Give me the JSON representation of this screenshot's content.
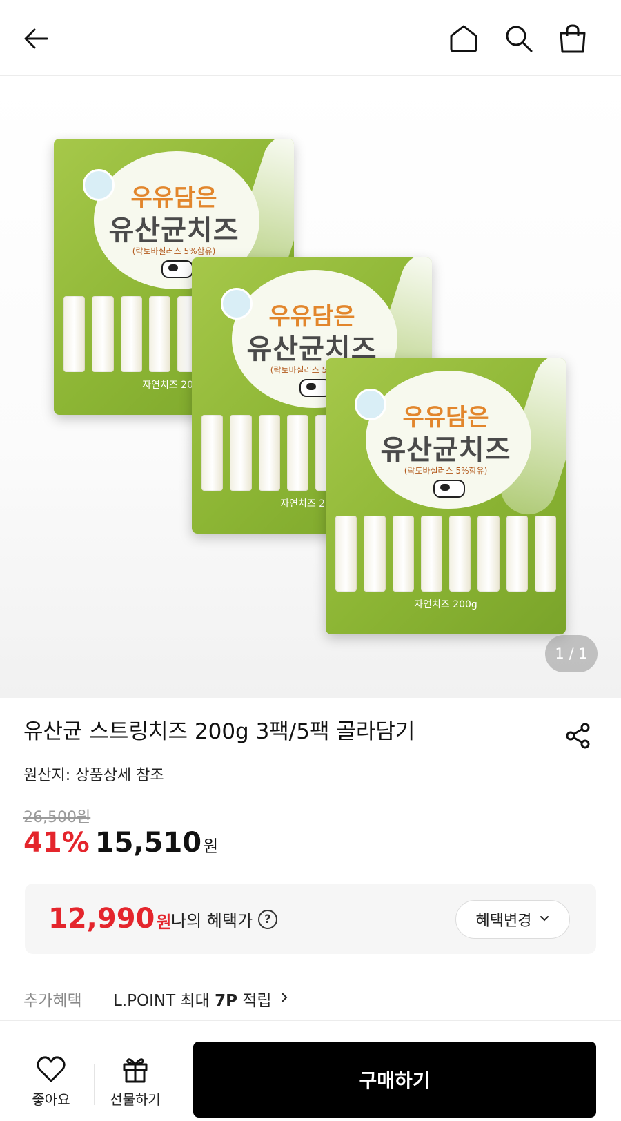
{
  "header": {
    "back_icon": "arrow-left-icon",
    "home_icon": "home-icon",
    "search_icon": "search-icon",
    "cart_icon": "shopping-bag-icon"
  },
  "gallery": {
    "counter": "1 / 1",
    "package": {
      "line1": "우유담은",
      "line2": "유산균치즈",
      "line3": "(락토바실러스 5%함유)",
      "net_weight": "자연치즈 200g"
    }
  },
  "product": {
    "title": "유산균 스트링치즈 200g 3팩/5팩 골라담기",
    "origin": "원산지: 상품상세 참조",
    "original_price": "26,500원",
    "discount": "41%",
    "price": "15,510",
    "currency": "원"
  },
  "benefit": {
    "price": "12,990",
    "currency": "원",
    "label": "나의 혜택가",
    "help_icon": "question-circle-icon",
    "change_label": "혜택변경"
  },
  "extra_benefit": {
    "label": "추가혜택",
    "value_prefix": "L.POINT 최대 ",
    "value_bold": "7P",
    "value_suffix": " 적립"
  },
  "bottom_bar": {
    "like_label": "좋아요",
    "gift_label": "선물하기",
    "buy_label": "구매하기"
  },
  "colors": {
    "accent_red": "#e4252c",
    "buy_button": "#000000",
    "package_green": "#8cb534"
  }
}
